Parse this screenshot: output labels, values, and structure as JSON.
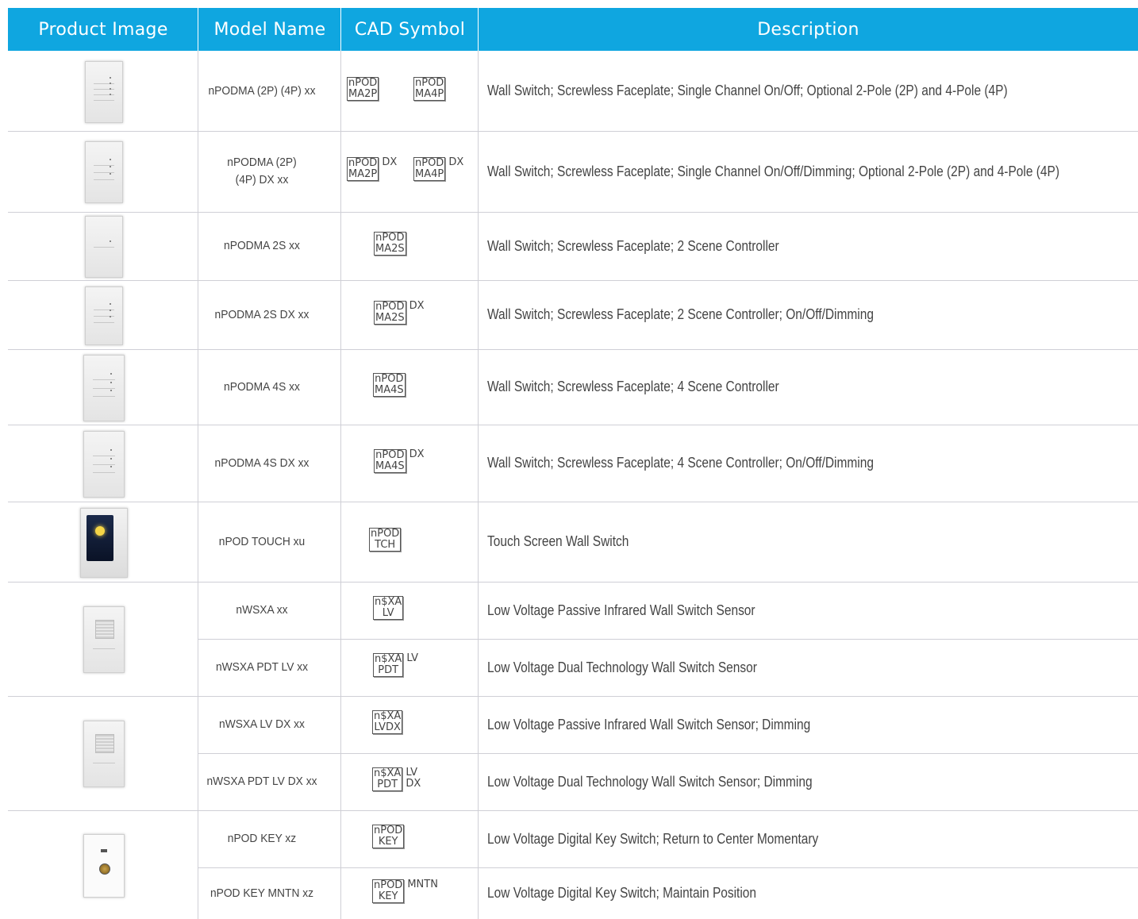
{
  "headers": {
    "product_image": "Product Image",
    "model_name": "Model Name",
    "cad_symbol": "CAD Symbol",
    "description": "Description"
  },
  "rows": [
    {
      "model": "nPODMA (2P) (4P) xx",
      "description": "Wall Switch; Screwless Faceplate; Single Channel On/Off; Optional 2-Pole (2P) and 4-Pole (4P)",
      "cad": [
        {
          "l1": "nPOD",
          "l2": "MA2P",
          "suffix": ""
        },
        {
          "l1": "nPOD",
          "l2": "MA4P",
          "suffix": ""
        }
      ]
    },
    {
      "model": "nPODMA (2P) (4P) DX xx",
      "description": "Wall Switch; Screwless Faceplate; Single Channel On/Off/Dimming; Optional 2-Pole (2P) and 4-Pole (4P)",
      "cad": [
        {
          "l1": "nPOD",
          "l2": "MA2P",
          "suffix": "DX"
        },
        {
          "l1": "nPOD",
          "l2": "MA4P",
          "suffix": "DX"
        }
      ]
    },
    {
      "model": "nPODMA 2S xx",
      "description": "Wall Switch; Screwless Faceplate; 2 Scene Controller",
      "cad": [
        {
          "l1": "nPOD",
          "l2": "MA2S",
          "suffix": ""
        }
      ]
    },
    {
      "model": "nPODMA 2S DX xx",
      "description": "Wall Switch; Screwless Faceplate; 2 Scene Controller; On/Off/Dimming",
      "cad": [
        {
          "l1": "nPOD",
          "l2": "MA2S",
          "suffix": "DX"
        }
      ]
    },
    {
      "model": "nPODMA 4S xx",
      "description": "Wall Switch; Screwless Faceplate; 4 Scene Controller",
      "cad": [
        {
          "l1": "nPOD",
          "l2": "MA4S",
          "suffix": ""
        }
      ]
    },
    {
      "model": "nPODMA 4S DX xx",
      "description": "Wall Switch; Screwless Faceplate; 4 Scene Controller; On/Off/Dimming",
      "cad": [
        {
          "l1": "nPOD",
          "l2": "MA4S",
          "suffix": "DX"
        }
      ]
    },
    {
      "model": "nPOD TOUCH xu",
      "description": "Touch Screen Wall Switch",
      "cad": [
        {
          "l1": "nPOD",
          "l2": "TCH",
          "suffix": ""
        }
      ]
    },
    {
      "model": "nWSXA xx",
      "description": "Low Voltage Passive Infrared Wall Switch Sensor",
      "cad": [
        {
          "l1": "n$XA",
          "l2": "LV",
          "suffix": ""
        }
      ]
    },
    {
      "model": "nWSXA PDT LV xx",
      "description": "Low Voltage Dual Technology Wall Switch Sensor",
      "cad": [
        {
          "l1": "n$XA",
          "l2": "PDT",
          "suffix": "LV"
        }
      ]
    },
    {
      "model": "nWSXA LV DX xx",
      "description": "Low Voltage Passive Infrared Wall Switch Sensor; Dimming",
      "cad": [
        {
          "l1": "n$XA",
          "l2": "LVDX",
          "suffix": ""
        }
      ]
    },
    {
      "model": "nWSXA PDT LV DX xx",
      "description": "Low Voltage Dual Technology Wall Switch Sensor; Dimming",
      "cad": [
        {
          "l1": "n$XA",
          "l2": "PDT",
          "suffix": "LV\nDX"
        }
      ]
    },
    {
      "model": "nPOD KEY xz",
      "description": "Low Voltage Digital Key Switch; Return to Center Momentary",
      "cad": [
        {
          "l1": "nPOD",
          "l2": "KEY",
          "suffix": ""
        }
      ]
    },
    {
      "model": "nPOD KEY MNTN xz",
      "description": "Low Voltage Digital Key Switch; Maintain Position",
      "cad": [
        {
          "l1": "nPOD",
          "l2": "KEY",
          "suffix": "MNTN"
        }
      ]
    }
  ],
  "product_images": [
    {
      "name": "wall-switch-2p-4p-image",
      "kind": "switch"
    },
    {
      "name": "wall-switch-2p-4p-dx-image",
      "kind": "switch"
    },
    {
      "name": "wall-switch-2s-image",
      "kind": "switch"
    },
    {
      "name": "wall-switch-2s-dx-image",
      "kind": "switch"
    },
    {
      "name": "wall-switch-4s-image",
      "kind": "switch"
    },
    {
      "name": "wall-switch-4s-dx-image",
      "kind": "switch"
    },
    {
      "name": "touch-screen-switch-image",
      "kind": "touch"
    },
    {
      "name": "wall-switch-sensor-image",
      "kind": "sensor"
    },
    {
      "name": "wall-switch-sensor-dimming-image",
      "kind": "sensor"
    },
    {
      "name": "digital-key-switch-image",
      "kind": "key"
    }
  ],
  "colors": {
    "header_bg": "#0fa6e0",
    "header_text": "#ffffff",
    "grid": "#cfcfd6",
    "text": "#444444"
  }
}
